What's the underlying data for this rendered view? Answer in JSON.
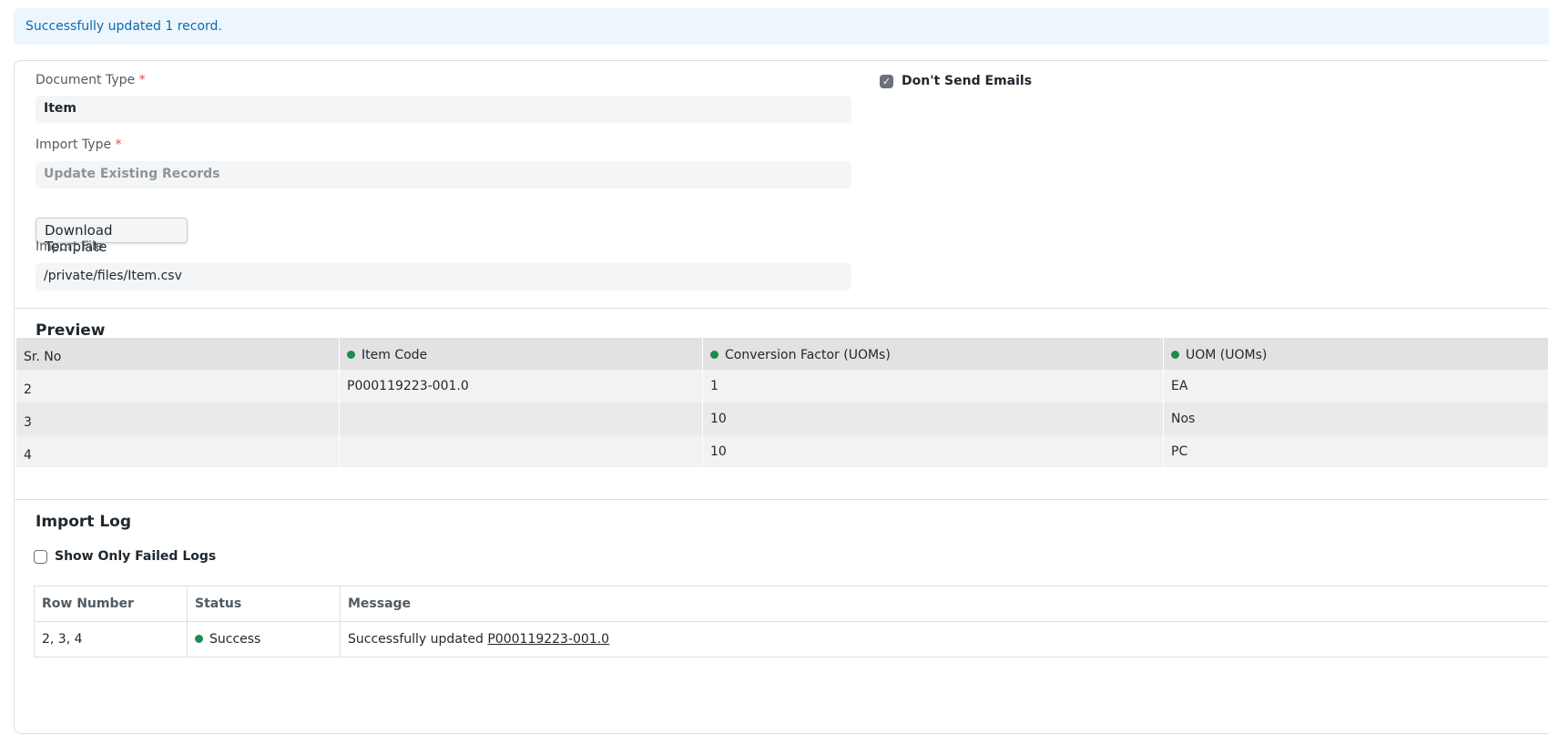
{
  "alert": {
    "message": "Successfully updated 1 record."
  },
  "form": {
    "document_type": {
      "label": "Document Type",
      "required_mark": "*",
      "value": "Item"
    },
    "import_type": {
      "label": "Import Type",
      "required_mark": "*",
      "value": "Update Existing Records"
    },
    "download_template_label": "Download Template",
    "import_file": {
      "label": "Import File",
      "value": "/private/files/Item.csv"
    },
    "dont_send_emails": {
      "label": "Don't Send Emails",
      "checked": true
    }
  },
  "preview": {
    "title": "Preview",
    "columns": [
      "Sr. No",
      "Item Code",
      "Conversion Factor (UOMs)",
      "UOM (UOMs)"
    ],
    "rows": [
      [
        "2",
        "P000119223-001.0",
        "1",
        "EA"
      ],
      [
        "3",
        "",
        "10",
        "Nos"
      ],
      [
        "4",
        "",
        "10",
        "PC"
      ]
    ],
    "status_dot_color": "#1b8d52"
  },
  "import_log": {
    "title": "Import Log",
    "show_only_failed": {
      "label": "Show Only Failed Logs",
      "checked": false
    },
    "columns": [
      "Row Number",
      "Status",
      "Message"
    ],
    "rows": [
      {
        "row_number": "2, 3, 4",
        "status": "Success",
        "message_prefix": "Successfully updated",
        "message_link": "P000119223-001.0"
      }
    ]
  },
  "colors": {
    "alert_bg": "#edf6fd",
    "alert_text": "#0a6bb0",
    "success": "#1b8d52",
    "required": "#e24c4c"
  }
}
